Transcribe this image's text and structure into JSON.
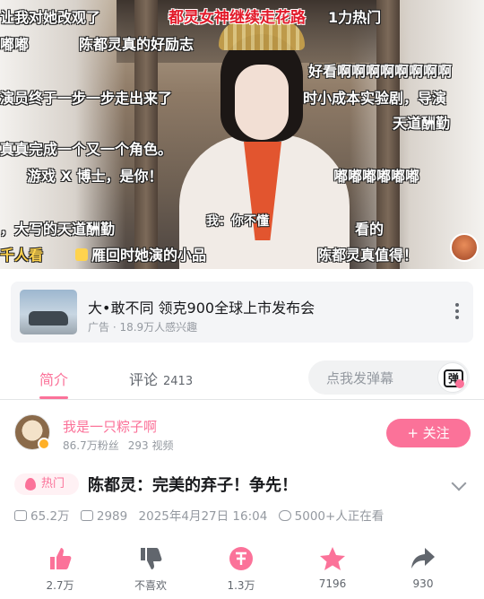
{
  "video": {
    "danmaku": [
      "让我对她改观了",
      "都灵女神继续走花路",
      "1力热门",
      "嘟嘟",
      "陈都灵真的好励志",
      "好看啊啊啊啊啊啊啊啊",
      "演员终于一步一步走出来了",
      "时小成本实验剧，导演",
      "天道酬勤",
      "真真完成一个又一个角色。",
      "游戏 X 博士，是你！",
      "嘟嘟嘟嘟嘟嘟",
      "，大写的天道酬勤",
      "我：你不懂",
      "看的",
      "千人看",
      "雁回时她演的小品",
      "陈都灵真值得！"
    ]
  },
  "ad": {
    "title": "大•敢不同 领克900全球上市发布会",
    "subtitle": "广告 · 18.9万人感兴趣"
  },
  "tabs": {
    "intro": "简介",
    "comments": "评论",
    "comment_count": "2413",
    "danmu_placeholder": "点我发弹幕",
    "danmu_icon_text": "弹"
  },
  "uploader": {
    "name": "我是一只粽子啊",
    "fans": "86.7万粉丝",
    "videos": "293 视频",
    "follow_label": "+ 关注"
  },
  "video_info": {
    "hot_label": "热门",
    "title": "陈都灵：完美的弃子！争先！",
    "views": "65.2万",
    "danmaku_count": "2989",
    "date": "2025年4月27日 16:04",
    "watching": "5000+人正在看"
  },
  "actions": {
    "like": "2.7万",
    "dislike": "不喜欢",
    "coin": "1.3万",
    "favorite": "7196",
    "share": "930"
  },
  "colors": {
    "accent": "#fb7299",
    "text_secondary": "#9499a0"
  }
}
